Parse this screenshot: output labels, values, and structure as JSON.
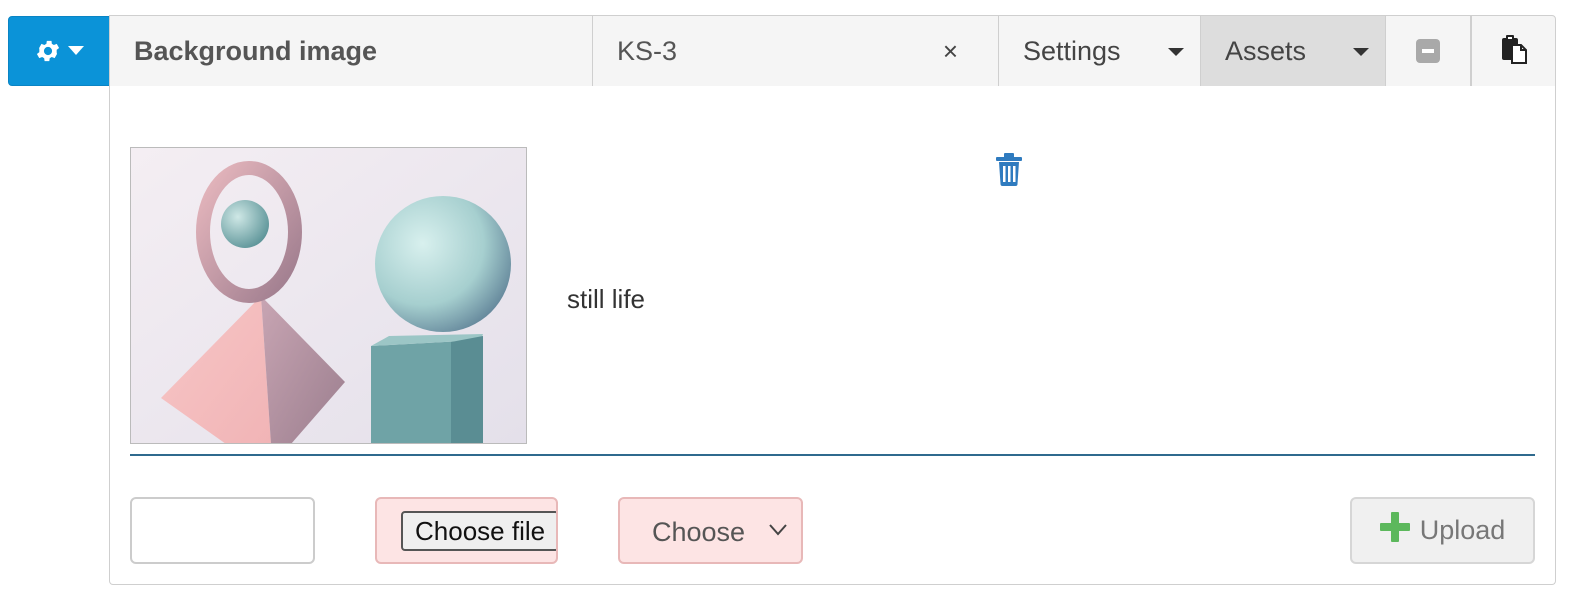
{
  "toolbar": {
    "gear_icon": "gear-icon",
    "gear_menu_caret": "caret-down-icon",
    "accent_color": "#0b93d8"
  },
  "header": {
    "title": "Background image",
    "name_value": "KS-3",
    "clear_label": "×",
    "settings_label": "Settings",
    "assets_label": "Assets",
    "collapse_icon": "minus-square-icon",
    "paste_icon": "paste-icon"
  },
  "asset": {
    "caption": "still life",
    "delete_icon": "trash-icon",
    "image_description_icon": "image-thumbnail"
  },
  "upload_form": {
    "text_value": "",
    "file_button_label": "Choose file",
    "select_value": "Choose",
    "upload_label": "Upload",
    "upload_icon": "plus-icon"
  }
}
